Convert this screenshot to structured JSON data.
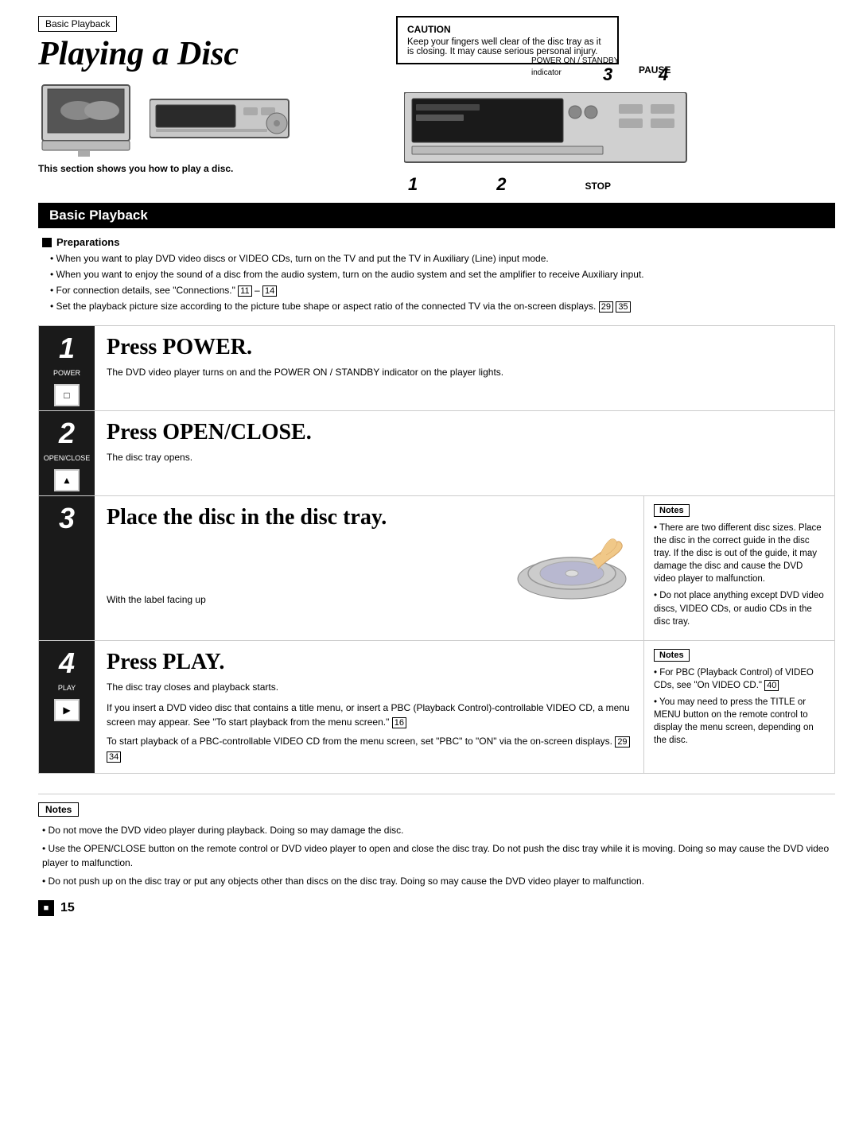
{
  "breadcrumb": "Basic Playback",
  "page_title": "Playing a Disc",
  "caution": {
    "title": "CAUTION",
    "text": "Keep your fingers well clear of the disc tray as it is closing. It may cause serious personal injury."
  },
  "section_title": "Basic Playback",
  "caption": "This section shows you how to play a disc.",
  "preparations": {
    "title": "Preparations",
    "items": [
      "When you want to play DVD video discs or VIDEO CDs, turn on the TV and put the TV in Auxiliary (Line) input mode.",
      "When you want to enjoy the sound of a disc from the audio system, turn on the audio system and set the amplifier to receive Auxiliary input.",
      "For connection details, see \"Connections.\" [11] – [14]",
      "Set the playback picture size according to the picture tube shape or aspect ratio of the connected TV via the on-screen displays. [29] [35]"
    ]
  },
  "steps": [
    {
      "number": "1",
      "label": "POWER",
      "icon": "□",
      "action": "Press POWER.",
      "description": "The DVD video player turns on and the POWER ON / STANDBY indicator on the player lights.",
      "has_notes": false
    },
    {
      "number": "2",
      "label": "OPEN/CLOSE",
      "icon": "▲",
      "action": "Press OPEN/CLOSE.",
      "description": "The disc tray opens.",
      "has_notes": false
    },
    {
      "number": "3",
      "label": "",
      "icon": "",
      "action": "Place the disc in the disc tray.",
      "description": "With the label facing up",
      "has_notes": true,
      "notes": [
        "There are two different disc sizes. Place the disc in the correct guide in the disc tray. If the disc is out of the guide, it may damage the disc and cause the DVD video player to malfunction.",
        "Do not place anything except DVD video discs, VIDEO CDs, or audio CDs in the disc tray."
      ]
    },
    {
      "number": "4",
      "label": "PLAY",
      "icon": "▶",
      "action": "Press PLAY.",
      "description_parts": [
        "The disc tray closes and playback starts.",
        "If you insert a DVD video disc that contains a title menu, or insert a PBC (Playback Control)-controllable VIDEO CD, a menu screen may appear. See \"To start playback from the menu screen.\" [16]",
        "To start playback of a PBC-controllable VIDEO CD from the menu screen, set \"PBC\" to \"ON\" via the on-screen displays. [29] [34]"
      ],
      "has_notes": true,
      "notes": [
        "For PBC (Playback Control) of VIDEO CDs, see \"On VIDEO CD.\" [40]",
        "You may need to press the TITLE or MENU button on the remote control to display the menu screen, depending on the disc."
      ]
    }
  ],
  "panel_labels": {
    "power_standby": "POWER ON / STANDBY",
    "indicator": "indicator",
    "num3": "3",
    "pause": "PAUSE",
    "num4": "4",
    "num1": "1",
    "num2": "2",
    "stop": "STOP"
  },
  "bottom_notes": {
    "title": "Notes",
    "items": [
      "Do not move the DVD video player during playback. Doing so may damage the disc.",
      "Use the OPEN/CLOSE button on the remote control or DVD video player to open and close the disc tray. Do not push the disc tray while it is moving. Doing so may cause the DVD video player to malfunction.",
      "Do not push up on the disc tray or put any objects other than discs on the disc tray. Doing so may cause the DVD video player to malfunction."
    ]
  },
  "page_number": "15"
}
